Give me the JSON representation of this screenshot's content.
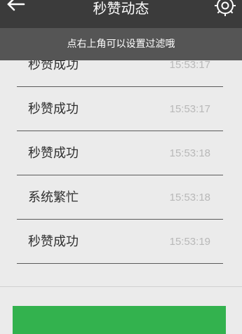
{
  "header": {
    "title": "秒赞动态",
    "back_icon": "arrow-left-icon",
    "settings_icon": "gear-icon"
  },
  "hint": {
    "text": "点右上角可以设置过滤哦"
  },
  "list": {
    "items": [
      {
        "label": "秒赞成功",
        "time": "15:53:17"
      },
      {
        "label": "秒赞成功",
        "time": "15:53:17"
      },
      {
        "label": "秒赞成功",
        "time": "15:53:18"
      },
      {
        "label": "系统繁忙",
        "time": "15:53:18"
      },
      {
        "label": "秒赞成功",
        "time": "15:53:19"
      }
    ]
  },
  "colors": {
    "topbar": "#3b3b3b",
    "hint_bar": "#555555",
    "background": "#ebebeb",
    "action_button": "#33b24e"
  }
}
